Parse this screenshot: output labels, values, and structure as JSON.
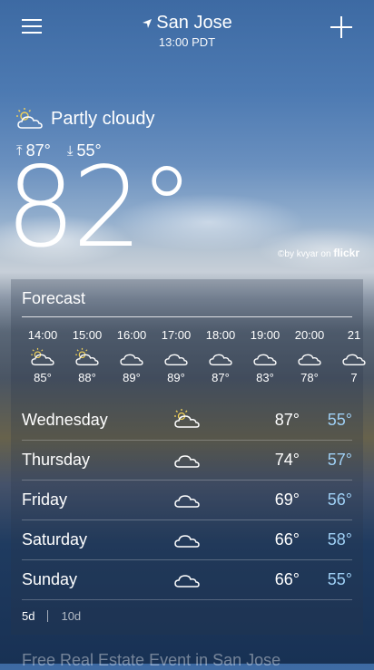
{
  "location": {
    "city": "San Jose",
    "time": "13:00 PDT"
  },
  "current": {
    "condition": "Partly cloudy",
    "high": "87°",
    "low": "55°",
    "temp": "82°"
  },
  "credit": {
    "prefix": "©by kvyar on",
    "brand": "flickr"
  },
  "forecast": {
    "title": "Forecast",
    "hourly": [
      {
        "hour": "14:00",
        "temp": "85°",
        "icon": "partly-cloudy-icon"
      },
      {
        "hour": "15:00",
        "temp": "88°",
        "icon": "partly-cloudy-icon"
      },
      {
        "hour": "16:00",
        "temp": "89°",
        "icon": "cloud-icon"
      },
      {
        "hour": "17:00",
        "temp": "89°",
        "icon": "cloud-icon"
      },
      {
        "hour": "18:00",
        "temp": "87°",
        "icon": "cloud-icon"
      },
      {
        "hour": "19:00",
        "temp": "83°",
        "icon": "cloud-icon"
      },
      {
        "hour": "20:00",
        "temp": "78°",
        "icon": "cloud-icon"
      },
      {
        "hour": "21",
        "temp": "7",
        "icon": "cloud-icon"
      }
    ],
    "daily": [
      {
        "day": "Wednesday",
        "high": "87°",
        "low": "55°",
        "icon": "partly-cloudy-icon"
      },
      {
        "day": "Thursday",
        "high": "74°",
        "low": "57°",
        "icon": "cloud-icon"
      },
      {
        "day": "Friday",
        "high": "69°",
        "low": "56°",
        "icon": "cloud-icon"
      },
      {
        "day": "Saturday",
        "high": "66°",
        "low": "58°",
        "icon": "cloud-icon"
      },
      {
        "day": "Sunday",
        "high": "66°",
        "low": "55°",
        "icon": "cloud-icon"
      }
    ],
    "range_5d": "5d",
    "range_10d": "10d"
  },
  "promo": "Free Real Estate Event in San Jose",
  "colors": {
    "low_temp": "#9fd0f5"
  }
}
